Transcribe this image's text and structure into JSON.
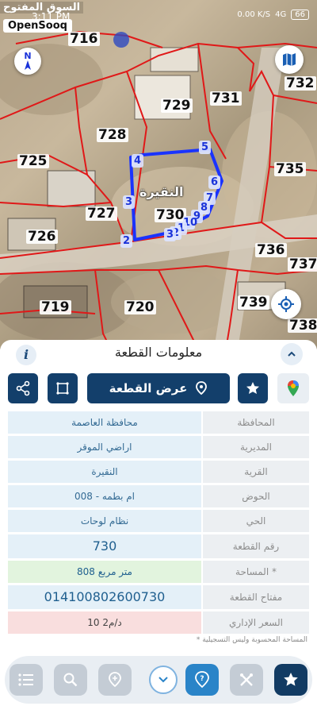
{
  "status_bar": {
    "time": "3:11 PM",
    "app_name": "السوق المفتوح",
    "speed": "0.00 K/S",
    "network": "4G",
    "battery": "66"
  },
  "brand": "OpenSooq",
  "map": {
    "compass_label": "N",
    "plot_name": "النقيرة",
    "parcels": [
      "716",
      "729",
      "731",
      "732",
      "728",
      "725",
      "735",
      "727",
      "730",
      "726",
      "736",
      "737",
      "739",
      "719",
      "720",
      "738"
    ],
    "vertices": [
      "1",
      "2",
      "3",
      "4",
      "5",
      "6",
      "7",
      "8",
      "9",
      "10",
      "11",
      "12",
      "13"
    ]
  },
  "panel": {
    "title": "معلومات القطعة",
    "info_label": "i",
    "show_plot_label": "عرض القطعة",
    "rows": [
      {
        "label": "المحافظة",
        "value": "محافظة العاصمة"
      },
      {
        "label": "المديرية",
        "value": "اراضي الموقر"
      },
      {
        "label": "القرية",
        "value": "النقيرة"
      },
      {
        "label": "الحوض",
        "value": "ام بطمه - 008"
      },
      {
        "label": "الحي",
        "value": "نظام لوحات"
      },
      {
        "label": "رقم القطعة",
        "value": "730"
      },
      {
        "label": "المساحة *",
        "value": "808  متر مربع"
      },
      {
        "label": "مفتاح القطعة",
        "value": "014100802600730"
      },
      {
        "label": "السعر الإداري",
        "value": "10 د/م2"
      }
    ],
    "footnote": "* المساحة المحسوبة وليس التسجيلية"
  },
  "colors": {
    "primary": "#133f6b",
    "accent": "#2a84c8",
    "plot_outline": "#1a33ff",
    "parcel_line": "#e01818"
  },
  "icons": [
    "compass-icon",
    "map-layers-icon",
    "locate-icon",
    "share-icon",
    "frame-icon",
    "pin-icon",
    "star-icon",
    "google-maps-icon",
    "list-icon",
    "search-icon",
    "location-pin-icon",
    "chevron-down-icon",
    "help-icon",
    "tools-icon",
    "favorites-icon"
  ]
}
